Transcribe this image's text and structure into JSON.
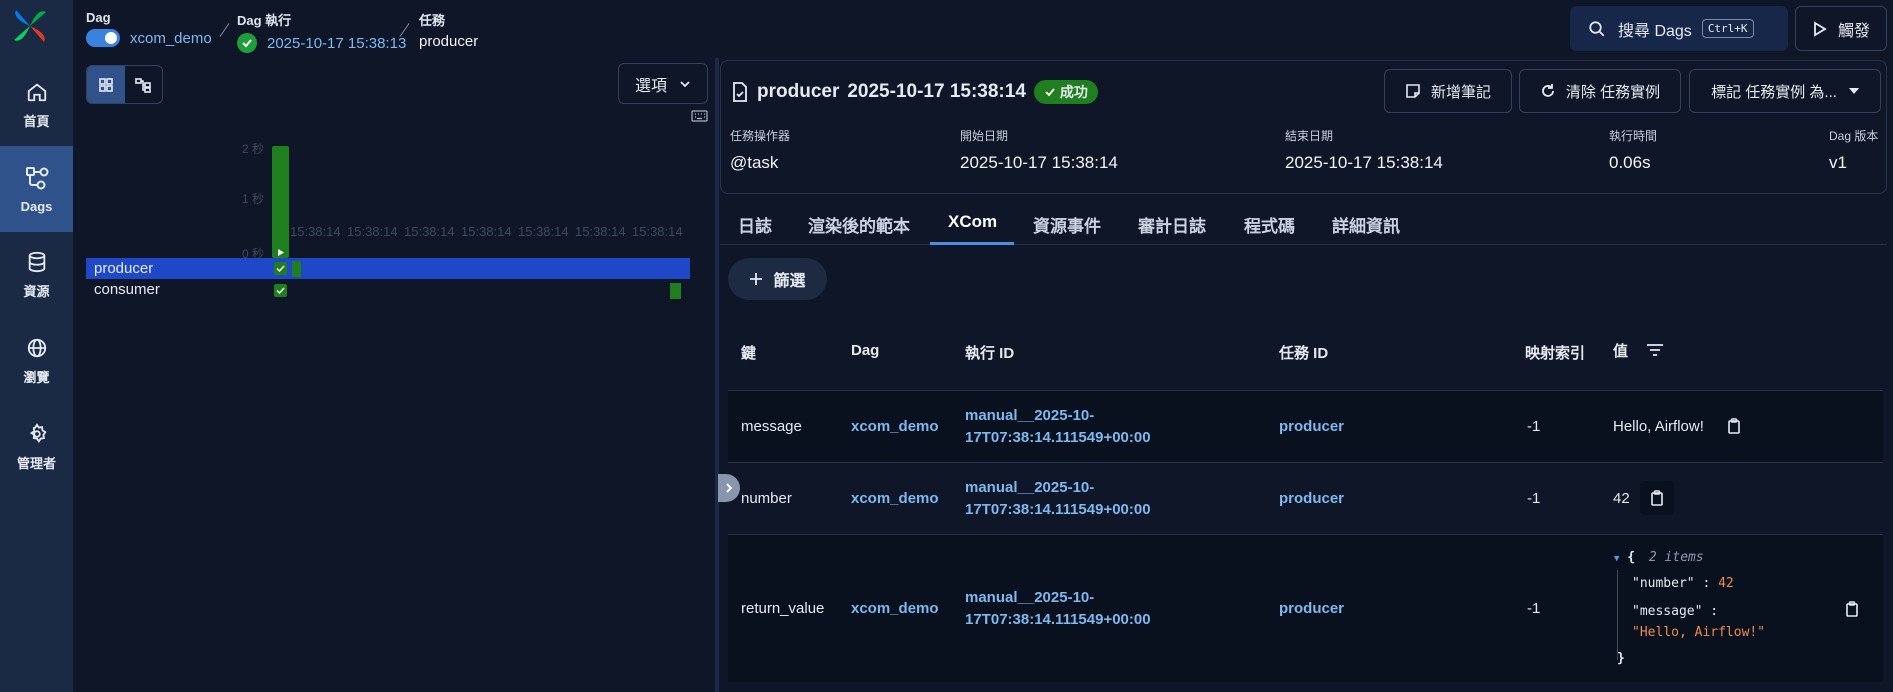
{
  "nav": {
    "items": [
      {
        "label": "首頁",
        "icon": "home-icon"
      },
      {
        "label": "Dags",
        "icon": "dags-icon"
      },
      {
        "label": "資源",
        "icon": "database-icon"
      },
      {
        "label": "瀏覽",
        "icon": "globe-icon"
      },
      {
        "label": "管理者",
        "icon": "gear-icon"
      }
    ]
  },
  "breadcrumb": {
    "dag_label": "Dag",
    "dag_value": "xcom_demo",
    "run_label": "Dag 執行",
    "run_value": "2025-10-17 15:38:13",
    "task_label": "任務",
    "task_value": "producer"
  },
  "header": {
    "search_label": "搜尋 Dags",
    "search_shortcut": "Ctrl+K",
    "trigger_label": "觸發"
  },
  "grid": {
    "options_label": "選項",
    "duration_ticks": [
      "2 秒",
      "1 秒",
      "0 秒"
    ],
    "time_labels": [
      "15:38:14",
      "15:38:14",
      "15:38:14",
      "15:38:14",
      "15:38:14",
      "15:38:14",
      "15:38:14"
    ],
    "tasks": [
      {
        "name": "producer",
        "selected": true
      },
      {
        "name": "consumer",
        "selected": false
      }
    ]
  },
  "task_instance": {
    "task": "producer",
    "date": "2025-10-17 15:38:14",
    "state": "成功",
    "actions": {
      "add_note": "新增筆記",
      "clear": "清除 任務實例",
      "mark": "標記 任務實例 為..."
    },
    "meta": {
      "operator_label": "任務操作器",
      "operator_value": "@task",
      "start_label": "開始日期",
      "start_value": "2025-10-17 15:38:14",
      "end_label": "結束日期",
      "end_value": "2025-10-17 15:38:14",
      "duration_label": "執行時間",
      "duration_value": "0.06s",
      "version_label": "Dag 版本",
      "version_value": "v1"
    }
  },
  "tabs": [
    "日誌",
    "渲染後的範本",
    "XCom",
    "資源事件",
    "審計日誌",
    "程式碼",
    "詳細資訊"
  ],
  "xcom": {
    "filter_label": "篩選",
    "columns": [
      "鍵",
      "Dag",
      "執行 ID",
      "任務 ID",
      "映射索引",
      "值"
    ],
    "rows": [
      {
        "key": "message",
        "dag": "xcom_demo",
        "run_id_1": "manual__2025-10-",
        "run_id_2": "17T07:38:14.111549+00:00",
        "task_id": "producer",
        "map_index": "-1",
        "value": "Hello, Airflow!"
      },
      {
        "key": "number",
        "dag": "xcom_demo",
        "run_id_1": "manual__2025-10-",
        "run_id_2": "17T07:38:14.111549+00:00",
        "task_id": "producer",
        "map_index": "-1",
        "value": "42"
      },
      {
        "key": "return_value",
        "dag": "xcom_demo",
        "run_id_1": "manual__2025-10-",
        "run_id_2": "17T07:38:14.111549+00:00",
        "task_id": "producer",
        "map_index": "-1",
        "value": ""
      }
    ],
    "json_value": {
      "open": "{",
      "count": "2 items",
      "k1": "\"number\"",
      "v1": "42",
      "k2": "\"message\"",
      "v2": "\"Hello, Airflow!\"",
      "close": "}"
    }
  }
}
